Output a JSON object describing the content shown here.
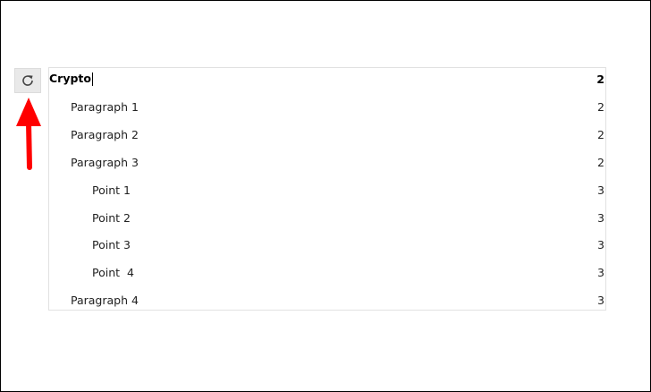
{
  "toolbar": {
    "refresh_icon": "refresh-icon"
  },
  "annotation": {
    "arrow_icon": "red-arrow-up-icon",
    "arrow_color": "#ff0000"
  },
  "toc": {
    "items": [
      {
        "label": "Crypto",
        "level": "2"
      },
      {
        "label": "Paragraph 1",
        "level": "2"
      },
      {
        "label": "Paragraph 2",
        "level": "2"
      },
      {
        "label": "Paragraph 3",
        "level": "2"
      },
      {
        "label": "Point 1",
        "level": "3"
      },
      {
        "label": "Point 2",
        "level": "3"
      },
      {
        "label": "Point 3",
        "level": "3"
      },
      {
        "label": "Point  4",
        "level": "3"
      },
      {
        "label": "Paragraph 4",
        "level": "3"
      }
    ]
  }
}
